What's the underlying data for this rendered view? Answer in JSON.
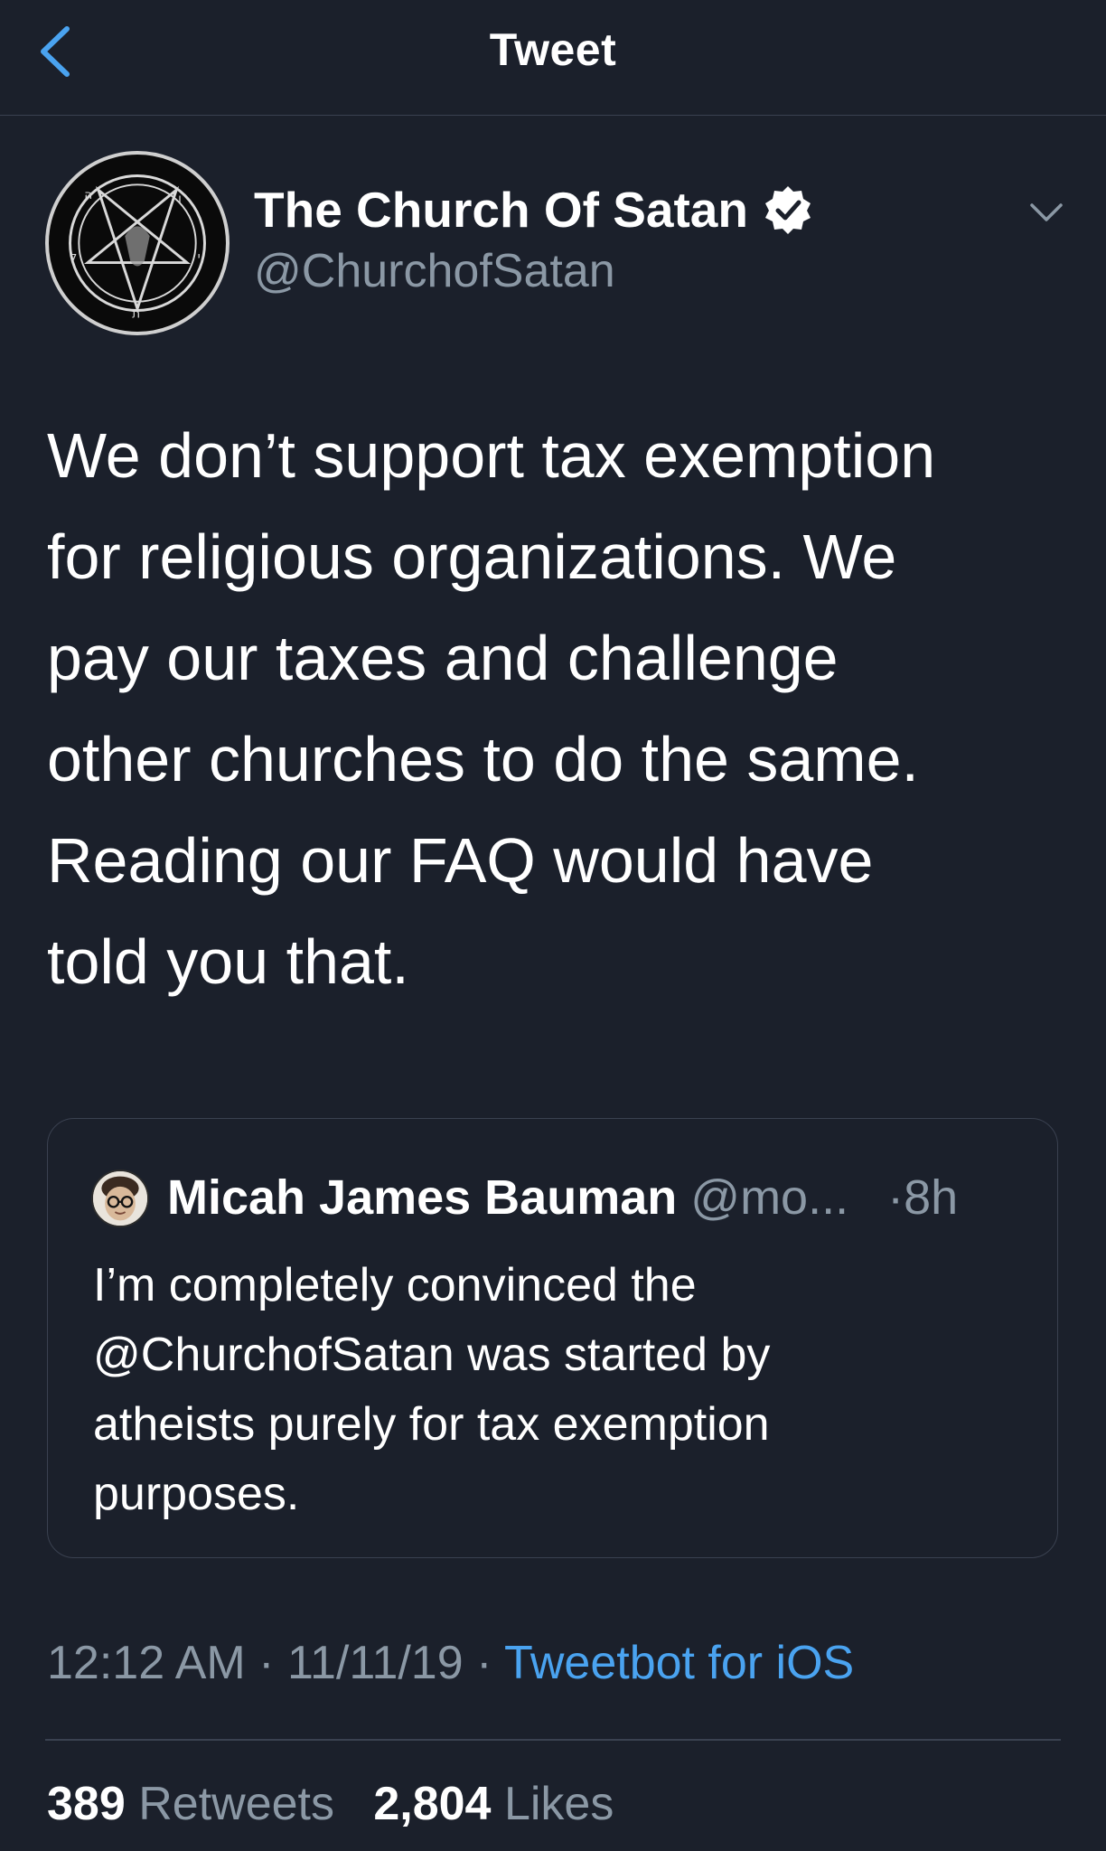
{
  "header": {
    "title": "Tweet",
    "back_icon": "chevron-left-icon"
  },
  "tweet": {
    "author": {
      "name": "The Church Of Satan",
      "handle": "@ChurchofSatan",
      "verified_icon": "verified-badge-icon",
      "avatar_icon": "pentagram-sigil-icon"
    },
    "text_lines": [
      "We don’t support tax exemption",
      "for religious organizations. We",
      "pay our taxes and challenge",
      "other churches to do the same.",
      "Reading our FAQ would have",
      "told you that."
    ],
    "quote": {
      "name": "Micah James Bauman",
      "handle": "@mo...",
      "time": "·8h",
      "text_lines": [
        "I’m completely convinced the",
        "@ChurchofSatan was started by",
        "atheists purely for tax exemption",
        "purposes."
      ]
    },
    "meta": {
      "time": "12:12 AM",
      "sep": "·",
      "date": "11/11/19",
      "source": "Tweetbot for iOS"
    },
    "stats": {
      "retweets_count": "389",
      "retweets_label": "Retweets",
      "likes_count": "2,804",
      "likes_label": "Likes"
    }
  },
  "colors": {
    "background": "#1b202b",
    "secondary_text": "#8b98a5",
    "accent": "#4aa3f0",
    "divider": "#3a4150"
  }
}
